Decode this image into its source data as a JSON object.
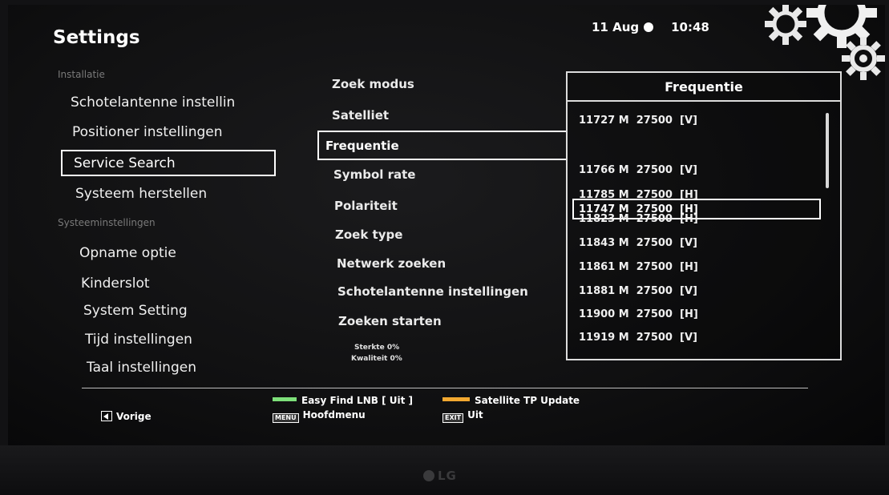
{
  "header": {
    "title": "Settings",
    "date": "11 Aug",
    "time": "10:48"
  },
  "sidebar": {
    "section_installatie": "Installatie",
    "section_systeem": "Systeeminstellingen",
    "items": [
      {
        "label": "Schotelantenne instellin"
      },
      {
        "label": "Positioner instellingen"
      },
      {
        "label": "Service Search"
      },
      {
        "label": "Systeem herstellen"
      },
      {
        "label": "Opname optie"
      },
      {
        "label": "Kinderslot"
      },
      {
        "label": "System Setting"
      },
      {
        "label": "Tijd instellingen"
      },
      {
        "label": "Taal instellingen"
      }
    ],
    "selected": "Service Search"
  },
  "options": {
    "items": [
      {
        "label": "Zoek modus"
      },
      {
        "label": "Satelliet"
      },
      {
        "label": "Frequentie"
      },
      {
        "label": "Symbol rate"
      },
      {
        "label": "Polariteit"
      },
      {
        "label": "Zoek type"
      },
      {
        "label": "Netwerk zoeken"
      },
      {
        "label": "Schotelantenne instellingen"
      },
      {
        "label": "Zoeken starten"
      }
    ],
    "selected": "Frequentie",
    "signal_strength": "Sterkte 0%",
    "signal_quality": "Kwaliteit 0%"
  },
  "frequency_list": {
    "title": "Frequentie",
    "rows": [
      {
        "label": "11727 M  27500  [V]"
      },
      {
        "label": "11747 M  27500  [H]"
      },
      {
        "label": "11766 M  27500  [V]"
      },
      {
        "label": "11785 M  27500  [H]"
      },
      {
        "label": "11823 M  27500  [H]"
      },
      {
        "label": "11843 M  27500  [V]"
      },
      {
        "label": "11861 M  27500  [H]"
      },
      {
        "label": "11881 M  27500  [V]"
      },
      {
        "label": "11900 M  27500  [H]"
      },
      {
        "label": "11919 M  27500  [V]"
      }
    ],
    "selected": "11747 M  27500  [H]"
  },
  "footer": {
    "back_label": "Vorige",
    "green_label": "Easy Find LNB [ Uit ]",
    "orange_label": "Satellite TP Update",
    "menu_key": "MENU",
    "menu_label": "Hoofdmenu",
    "exit_key": "EXIT",
    "exit_label": "Uit"
  },
  "tv": {
    "brand": "LG"
  },
  "colors": {
    "green_key": "#7ee07a",
    "orange_key": "#f2a830",
    "highlight_border": "#ffffff"
  }
}
